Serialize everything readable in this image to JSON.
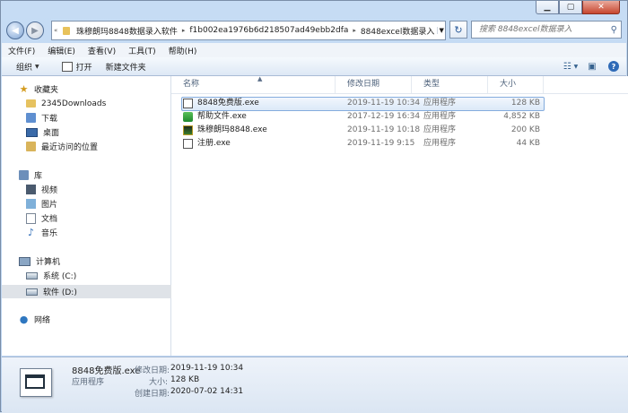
{
  "window": {
    "breadcrumb": [
      "珠穆朗玛8848数据录入软件",
      "f1b002ea1976b6d218507ad49ebb2dfa",
      "8848excel数据录入"
    ],
    "breadcrumb_prefix": "«",
    "search_placeholder": "搜索 8848excel数据录入"
  },
  "menu": [
    "文件(F)",
    "编辑(E)",
    "查看(V)",
    "工具(T)",
    "帮助(H)"
  ],
  "toolbar": {
    "organize": "组织",
    "open": "打开",
    "new_folder": "新建文件夹"
  },
  "nav": {
    "favorites": "收藏夹",
    "fav_items": [
      "2345Downloads",
      "下载",
      "桌面",
      "最近访问的位置"
    ],
    "libraries": "库",
    "lib_items": [
      "视频",
      "图片",
      "文档",
      "音乐"
    ],
    "computer": "计算机",
    "drives": [
      "系统 (C:)",
      "软件 (D:)"
    ],
    "network": "网络"
  },
  "columns": {
    "name": "名称",
    "modified": "修改日期",
    "type": "类型",
    "size": "大小"
  },
  "files": [
    {
      "name": "8848免费版.exe",
      "modified": "2019-11-19 10:34",
      "type": "应用程序",
      "size": "128 KB"
    },
    {
      "name": "帮助文件.exe",
      "modified": "2017-12-19 16:34",
      "type": "应用程序",
      "size": "4,852 KB"
    },
    {
      "name": "珠穆朗玛8848.exe",
      "modified": "2019-11-19 10:18",
      "type": "应用程序",
      "size": "200 KB"
    },
    {
      "name": "注册.exe",
      "modified": "2019-11-19 9:15",
      "type": "应用程序",
      "size": "44 KB"
    }
  ],
  "details": {
    "filename": "8848免费版.exe",
    "filetype": "应用程序",
    "modified_label": "修改日期:",
    "modified": "2019-11-19 10:34",
    "size_label": "大小:",
    "size": "128 KB",
    "created_label": "创建日期:",
    "created": "2020-07-02 14:31"
  }
}
